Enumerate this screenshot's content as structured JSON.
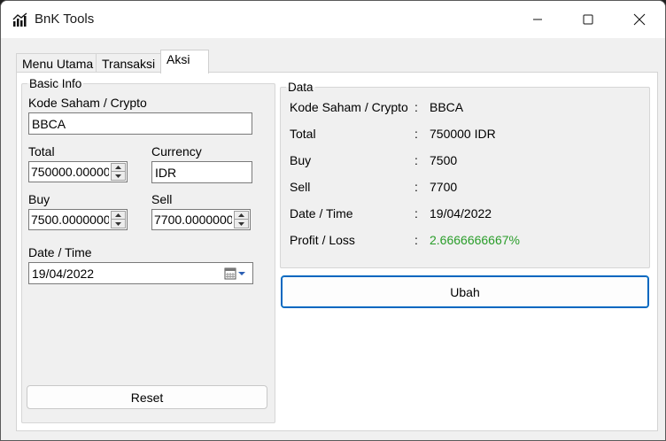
{
  "window": {
    "title": "BnK Tools",
    "icon": "chart-bars-icon"
  },
  "tabs": [
    {
      "label": "Menu Utama",
      "active": false
    },
    {
      "label": "Transaksi",
      "active": false
    },
    {
      "label": "Aksi",
      "active": true
    }
  ],
  "basic_info": {
    "legend": "Basic Info",
    "kode_label": "Kode Saham / Crypto",
    "kode_value": "BBCA",
    "total_label": "Total",
    "total_value": "750000.000000",
    "currency_label": "Currency",
    "currency_value": "IDR",
    "buy_label": "Buy",
    "buy_value": "7500.0000000",
    "sell_label": "Sell",
    "sell_value": "7700.0000000",
    "date_label": "Date / Time",
    "date_value": "19/04/2022",
    "reset_label": "Reset"
  },
  "data_panel": {
    "legend": "Data",
    "separator": ":",
    "rows": [
      {
        "label": "Kode Saham / Crypto",
        "value": "BBCA"
      },
      {
        "label": "Total",
        "value": "750000 IDR"
      },
      {
        "label": "Buy",
        "value": "7500"
      },
      {
        "label": "Sell",
        "value": "7700"
      },
      {
        "label": "Date / Time",
        "value": "19/04/2022"
      },
      {
        "label": "Profit / Loss",
        "value": "2.6666666667%"
      }
    ],
    "profit_color": "#2a9d2a",
    "ubah_label": "Ubah"
  },
  "colors": {
    "accent": "#0067c0"
  }
}
